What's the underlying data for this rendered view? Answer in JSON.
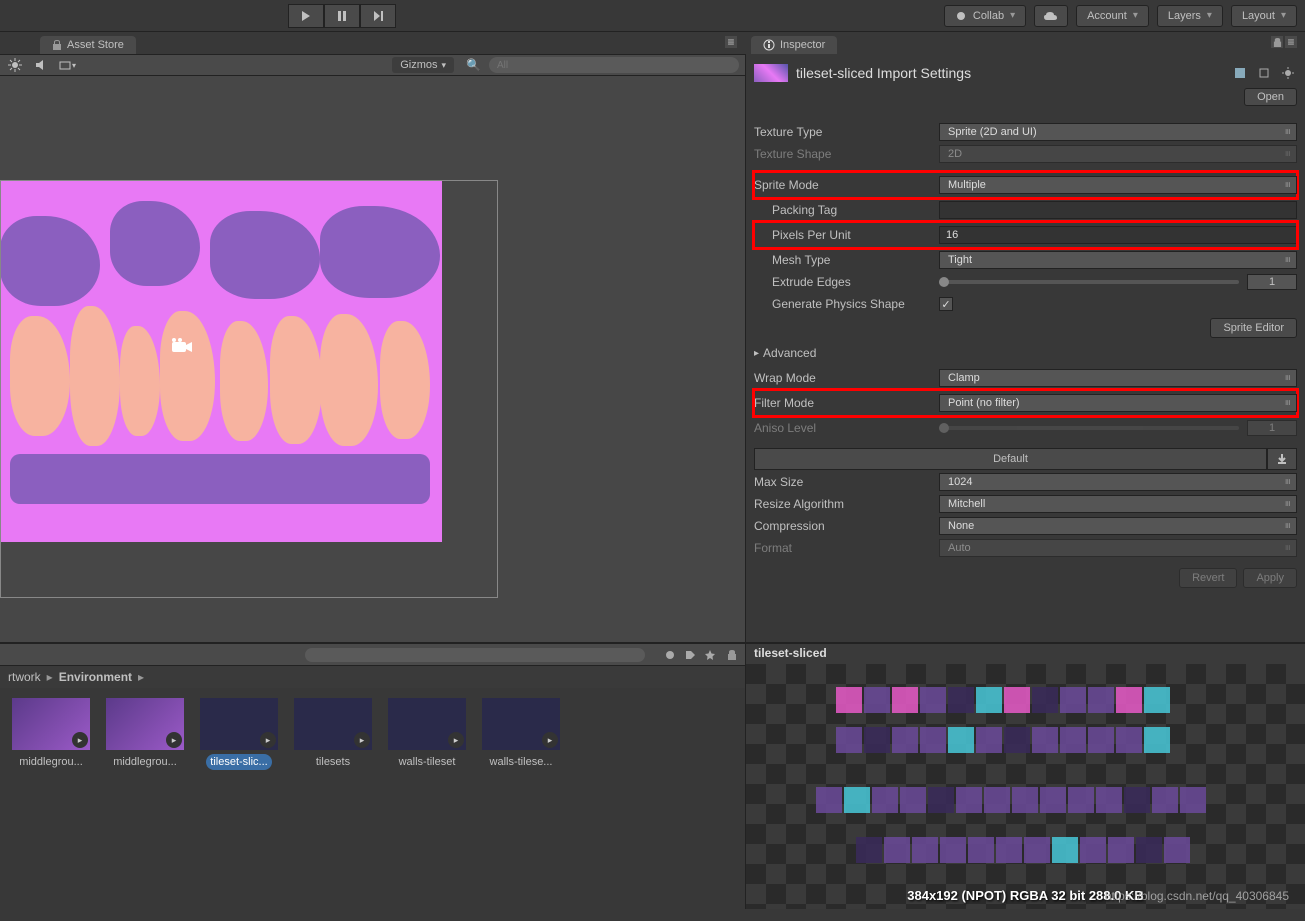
{
  "toolbar": {
    "collab": "Collab",
    "account": "Account",
    "layers": "Layers",
    "layout": "Layout"
  },
  "tabs": {
    "asset_store": "Asset Store",
    "inspector": "Inspector"
  },
  "viewport": {
    "gizmos": "Gizmos",
    "search_placeholder": "All"
  },
  "inspector": {
    "title": "tileset-sliced Import Settings",
    "open": "Open",
    "texture_type": {
      "label": "Texture Type",
      "value": "Sprite (2D and UI)"
    },
    "texture_shape": {
      "label": "Texture Shape",
      "value": "2D"
    },
    "sprite_mode": {
      "label": "Sprite Mode",
      "value": "Multiple"
    },
    "packing_tag": {
      "label": "Packing Tag",
      "value": ""
    },
    "pixels_per_unit": {
      "label": "Pixels Per Unit",
      "value": "16"
    },
    "mesh_type": {
      "label": "Mesh Type",
      "value": "Tight"
    },
    "extrude_edges": {
      "label": "Extrude Edges",
      "value": "1"
    },
    "generate_physics": {
      "label": "Generate Physics Shape"
    },
    "sprite_editor": "Sprite Editor",
    "advanced": "Advanced",
    "wrap_mode": {
      "label": "Wrap Mode",
      "value": "Clamp"
    },
    "filter_mode": {
      "label": "Filter Mode",
      "value": "Point (no filter)"
    },
    "aniso_level": {
      "label": "Aniso Level",
      "value": "1"
    },
    "default_tab": "Default",
    "max_size": {
      "label": "Max Size",
      "value": "1024"
    },
    "resize_algorithm": {
      "label": "Resize Algorithm",
      "value": "Mitchell"
    },
    "compression": {
      "label": "Compression",
      "value": "None"
    },
    "format": {
      "label": "Format",
      "value": "Auto"
    },
    "revert": "Revert",
    "apply": "Apply"
  },
  "breadcrumb": {
    "parent": "rtwork",
    "current": "Environment"
  },
  "assets": [
    {
      "name": "middlegrou..."
    },
    {
      "name": "middlegrou..."
    },
    {
      "name": "tileset-slic...",
      "selected": true
    },
    {
      "name": "tilesets"
    },
    {
      "name": "walls-tileset"
    },
    {
      "name": "walls-tilese..."
    }
  ],
  "preview": {
    "title": "tileset-sliced",
    "info": "384x192 (NPOT)  RGBA 32 bit    288.0 KB"
  },
  "watermark": "https://blog.csdn.net/qq_40306845"
}
